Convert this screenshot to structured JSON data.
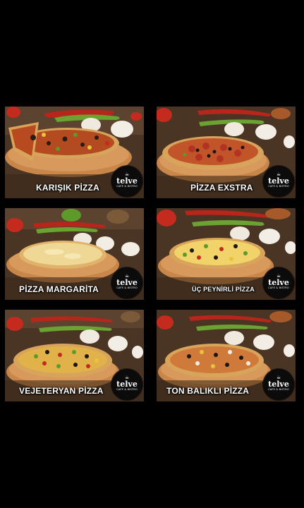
{
  "cards": [
    {
      "title": "KARIŞIK PİZZA",
      "topping": "mixed"
    },
    {
      "title": "PİZZA EXSTRA",
      "topping": "extra"
    },
    {
      "title": "PİZZA MARGARİTA",
      "topping": "margarita"
    },
    {
      "title": "ÜÇ PEYNİRLİ PİZZA",
      "topping": "three-cheese"
    },
    {
      "title": "VEJETERYAN PİZZA",
      "topping": "veggie"
    },
    {
      "title": "TON BALIKLI PİZZA",
      "topping": "tuna"
    }
  ],
  "logo": {
    "name": "telve",
    "subtitle": "CAFE & BISTRO",
    "icon": "coffee-cup-icon"
  },
  "colors": {
    "background": "#000000",
    "caption_text": "#ffffff",
    "logo_bg": "#0b0b0b",
    "wood": "#c9864a",
    "pepper_red": "#c8251c",
    "pepper_green": "#5e9a2a",
    "mushroom": "#f1ece3"
  }
}
